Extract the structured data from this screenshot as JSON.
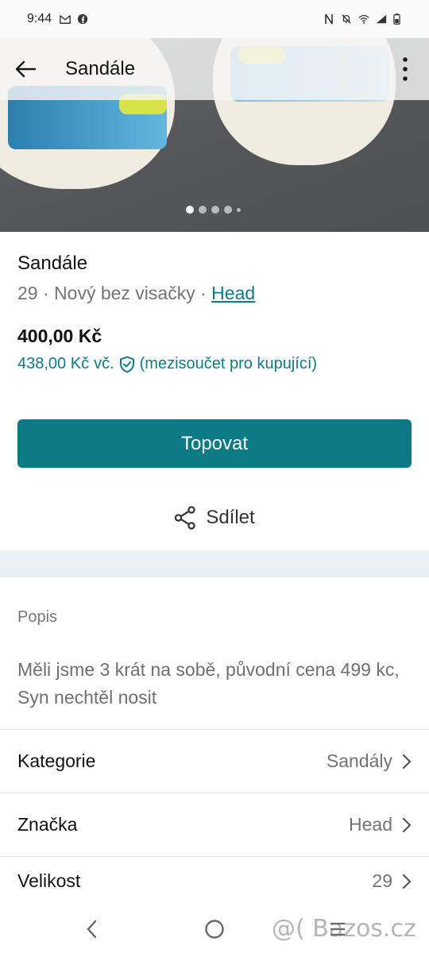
{
  "status_bar": {
    "time": "9:44",
    "left_icons": [
      "gmail-icon",
      "facebook-icon"
    ],
    "right_icons": [
      "nfc-icon",
      "mute-icon",
      "wifi-icon",
      "signal-icon",
      "battery-icon"
    ]
  },
  "app_bar": {
    "title": "Sandále",
    "back_icon": "arrow-left-icon",
    "more_icon": "more-vertical-icon"
  },
  "gallery": {
    "photo_count_dots": 5,
    "active_index": 0
  },
  "product": {
    "name": "Sandále",
    "size": "29",
    "separator": "·",
    "condition": "Nový bez visačky",
    "brand_link": "Head",
    "price": "400,00 Kč",
    "buyer_price": "438,00 Kč",
    "buyer_price_suffix": "vč.",
    "buyer_price_note": "(mezisoučet pro kupující)"
  },
  "actions": {
    "primary_button": "Topovat",
    "share_label": "Sdílet"
  },
  "description": {
    "heading": "Popis",
    "text": "Měli jsme 3 krát na sobě, původní cena 499 kc, Syn nechtěl nosit"
  },
  "details": [
    {
      "key": "Kategorie",
      "value": "Sandály"
    },
    {
      "key": "Značka",
      "value": "Head"
    },
    {
      "key": "Velikost",
      "value": "29"
    }
  ],
  "watermark": "@( Bazos.cz",
  "colors": {
    "accent": "#0b7a84",
    "link": "#0b7c86",
    "band": "#e9f1f2"
  }
}
